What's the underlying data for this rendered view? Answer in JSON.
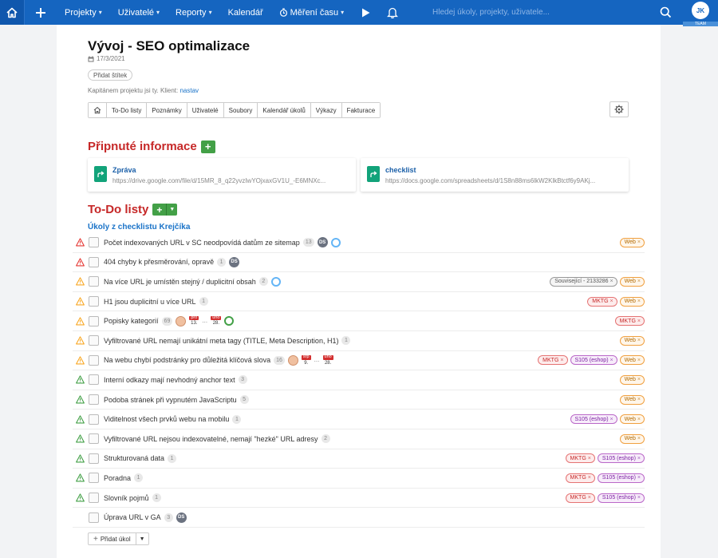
{
  "topbar": {
    "menu": [
      {
        "label": "Projekty",
        "dropdown": true
      },
      {
        "label": "Uživatelé",
        "dropdown": true
      },
      {
        "label": "Reporty",
        "dropdown": true
      },
      {
        "label": "Kalendář",
        "dropdown": false
      },
      {
        "label": "Měření času",
        "dropdown": true
      }
    ],
    "search_placeholder": "Hledej úkoly, projekty, uživatele...",
    "avatar_initials": "JK",
    "avatar_badge": "TEAM",
    "accent_color": "#1565c0"
  },
  "project": {
    "title": "Vývoj - SEO optimalizace",
    "date": "17/3/2021",
    "add_tag_label": "Přidat štítek",
    "owner_text": "Kapitánem projektu jsi ty. Klient:",
    "client_link": "nastav"
  },
  "tabs": [
    "To-Do listy",
    "Poznámky",
    "Uživatelé",
    "Soubory",
    "Kalendář úkolů",
    "Výkazy",
    "Fakturace"
  ],
  "pinned": {
    "heading": "Připnuté informace",
    "cards": [
      {
        "title": "Zpráva",
        "url": "https://drive.google.com/file/d/15MR_8_q22yvzIwYOjxaxGV1U_-E6MNXc..."
      },
      {
        "title": "checklist",
        "url": "https://docs.google.com/spreadsheets/d/1S8n88ms6lkW2KlkBtctf6y9AKj..."
      }
    ]
  },
  "todo": {
    "heading": "To-Do listy",
    "list_title": "Úkoly z checklistu Krejčíka",
    "add_task_label": "Přidat úkol",
    "tasks": [
      {
        "text": "Počet indexovaných URL v SC neodpovídá datům ze sitemap",
        "count": "13",
        "priority": "high",
        "ds": "DS",
        "ring": "blue",
        "tags": [
          {
            "label": "Web",
            "kind": "web"
          }
        ]
      },
      {
        "text": "404 chyby k přesměrování, opravě",
        "count": "1",
        "priority": "high",
        "ds": "DS",
        "tags": []
      },
      {
        "text": "Na více URL je umístěn stejný / duplicitní obsah",
        "count": "2",
        "priority": "medium",
        "ring": "blue",
        "tags": [
          {
            "label": "Související - 2133286",
            "kind": "souv"
          },
          {
            "label": "Web",
            "kind": "web"
          }
        ]
      },
      {
        "text": "H1 jsou duplicitní u více URL",
        "count": "1",
        "priority": "medium",
        "tags": [
          {
            "label": "MKTG",
            "kind": "mktg"
          },
          {
            "label": "Web",
            "kind": "web"
          }
        ]
      },
      {
        "text": "Popisky kategorií",
        "count": "69",
        "priority": "medium",
        "face": true,
        "dates": [
          {
            "m": "pro",
            "d": "13."
          },
          {
            "m": "úno",
            "d": "28."
          }
        ],
        "ring": "green",
        "tags": [
          {
            "label": "MKTG",
            "kind": "mktg"
          }
        ]
      },
      {
        "text": "Vyfiltrované URL nemají unikátní meta tagy (TITLE, Meta Description, H1)",
        "count": "1",
        "priority": "medium",
        "tags": [
          {
            "label": "Web",
            "kind": "web"
          }
        ]
      },
      {
        "text": "Na webu chybí podstránky pro důležitá klíčová slova",
        "count": "16",
        "priority": "medium",
        "face": true,
        "dates": [
          {
            "m": "srp",
            "d": "9."
          },
          {
            "m": "úno",
            "d": "28."
          }
        ],
        "tags": [
          {
            "label": "MKTG",
            "kind": "mktg"
          },
          {
            "label": "S105 (eshop)",
            "kind": "s105"
          },
          {
            "label": "Web",
            "kind": "web"
          }
        ]
      },
      {
        "text": "Interní odkazy mají nevhodný anchor text",
        "count": "3",
        "priority": "low",
        "tags": [
          {
            "label": "Web",
            "kind": "web"
          }
        ]
      },
      {
        "text": "Podoba stránek při vypnutém JavaScriptu",
        "count": "5",
        "priority": "low",
        "tags": [
          {
            "label": "Web",
            "kind": "web"
          }
        ]
      },
      {
        "text": "Viditelnost všech prvků webu na mobilu",
        "count": "1",
        "priority": "low",
        "tags": [
          {
            "label": "S105 (eshop)",
            "kind": "s105"
          },
          {
            "label": "Web",
            "kind": "web"
          }
        ]
      },
      {
        "text": "Vyfiltrované URL nejsou indexovatelné, nemají \"hezké\" URL adresy",
        "count": "2",
        "priority": "low",
        "tags": [
          {
            "label": "Web",
            "kind": "web"
          }
        ]
      },
      {
        "text": "Strukturovaná data",
        "count": "1",
        "priority": "low",
        "tags": [
          {
            "label": "MKTG",
            "kind": "mktg"
          },
          {
            "label": "S105 (eshop)",
            "kind": "s105"
          }
        ]
      },
      {
        "text": "Poradna",
        "count": "1",
        "priority": "low",
        "tags": [
          {
            "label": "MKTG",
            "kind": "mktg"
          },
          {
            "label": "S105 (eshop)",
            "kind": "s105"
          }
        ]
      },
      {
        "text": "Slovník pojmů",
        "count": "1",
        "priority": "low",
        "tags": [
          {
            "label": "MKTG",
            "kind": "mktg"
          },
          {
            "label": "S105 (eshop)",
            "kind": "s105"
          }
        ]
      },
      {
        "text": "Úprava URL v GA",
        "count": "3",
        "priority": "none",
        "ds": "DS",
        "tags": []
      }
    ]
  },
  "colors": {
    "high": "#e53935",
    "medium": "#f9a825",
    "low": "#43a047",
    "heading": "#c62828"
  }
}
